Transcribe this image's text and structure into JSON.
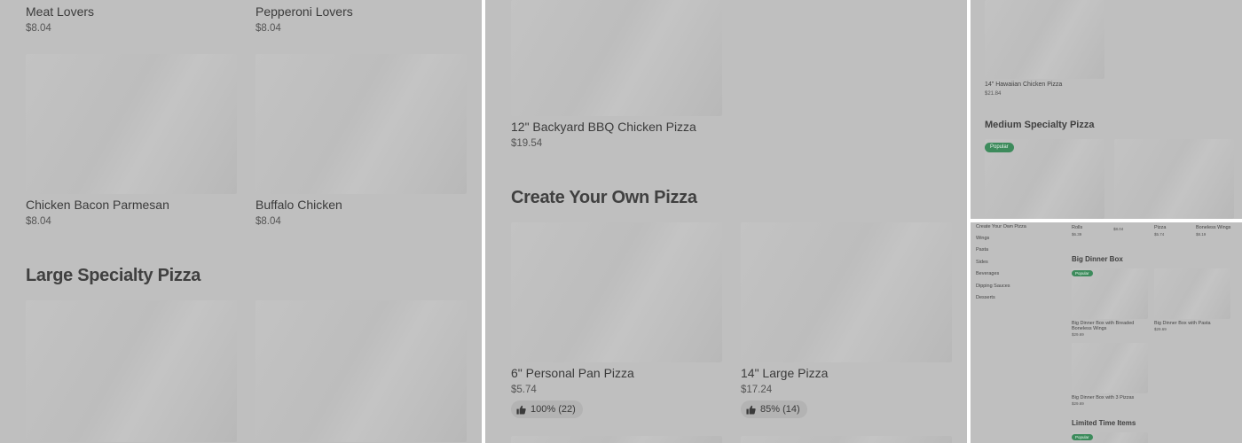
{
  "panel1": {
    "items": [
      {
        "name": "Meat Lovers",
        "price": "$8.04"
      },
      {
        "name": "Pepperoni Lovers",
        "price": "$8.04"
      },
      {
        "name": "Chicken Bacon Parmesan",
        "price": "$8.04"
      },
      {
        "name": "Buffalo Chicken",
        "price": "$8.04"
      }
    ],
    "section_title": "Large Specialty Pizza"
  },
  "panel2": {
    "top_item": {
      "name": "12\" Backyard BBQ Chicken Pizza",
      "price": "$19.54"
    },
    "section_title": "Create Your Own Pizza",
    "items": [
      {
        "name": "6\" Personal Pan Pizza",
        "price": "$5.74",
        "rating": "100% (22)"
      },
      {
        "name": "14\" Large Pizza",
        "price": "$17.24",
        "rating": "85% (14)"
      }
    ]
  },
  "panel3": {
    "top_item": {
      "name": "14\" Hawaiian Chicken Pizza",
      "price": "$21.84"
    },
    "section_title": "Medium Specialty Pizza",
    "badge": "Popular"
  },
  "panel4": {
    "sidebar": [
      "Create Your Own Pizza",
      "Wings",
      "Pasta",
      "Sides",
      "Beverages",
      "Dipping Sauces",
      "Desserts"
    ],
    "top_row": [
      {
        "name": "Rolls",
        "price": "$6.39"
      },
      {
        "name": "",
        "price": "$8.04"
      },
      {
        "name": "Pizza",
        "price": "$5.74"
      },
      {
        "name": "Boneless Wings",
        "price": "$8.19"
      }
    ],
    "section_title": "Big Dinner Box",
    "badge": "Popular",
    "items": [
      {
        "name_line1": "Big Dinner Box with Breaded",
        "name_line2": "Boneless Wings",
        "price": "$29.69"
      },
      {
        "name_line1": "Big Dinner Box with Pasta",
        "name_line2": "",
        "price": "$29.69"
      },
      {
        "name_line1": "Big Dinner Box with 3 Pizzas",
        "name_line2": "",
        "price": "$29.69"
      }
    ],
    "section2_title": "Limited Time Items",
    "badge2": "Popular"
  },
  "icons": {
    "rating": "thumbs-up-icon"
  },
  "colors": {
    "badge_green": "#3d8b5c",
    "panel_bg": "#bfbfbf"
  }
}
